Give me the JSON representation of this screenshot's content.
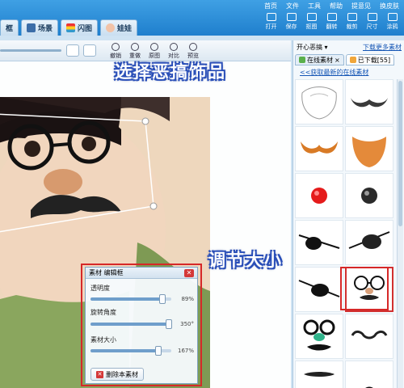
{
  "top_menu": [
    "首页",
    "文件",
    "工具",
    "帮助",
    "提意见",
    "换皮肤"
  ],
  "nav_tabs": [
    {
      "label": "框",
      "icon": "frame-icon"
    },
    {
      "label": "场景",
      "icon": "scene-icon"
    },
    {
      "label": "闪图",
      "icon": "flash-icon"
    },
    {
      "label": "娃娃",
      "icon": "doll-icon"
    }
  ],
  "toolbar": [
    "打开",
    "保存",
    "抠图",
    "翻转",
    "裁剪",
    "尺寸",
    "涂鸦"
  ],
  "edit_buttons": [
    "撤销",
    "重做",
    "原图",
    "对比",
    "预览"
  ],
  "right_panel": {
    "category": "开心恶搞",
    "download_more": "下载更多素材",
    "tabs": [
      {
        "label": "在线素材"
      },
      {
        "label": "已下载[55]"
      }
    ],
    "fetch_link": "<<获取最新的在线素材"
  },
  "annotations": {
    "select": "选择恶搞饰品",
    "resize": "调节大小"
  },
  "edit_box": {
    "title": "素材 编辑框",
    "opacity_label": "透明度",
    "opacity_value": "89%",
    "rotate_label": "旋转角度",
    "rotate_value": "350°",
    "size_label": "素材大小",
    "size_value": "167%",
    "delete_label": "删除本素材",
    "opacity": 0.89,
    "rotate": 350,
    "size": 1.67
  },
  "colors": {
    "header_blue": "#2a8ad8",
    "highlight_red": "#d62828",
    "annotation_outline": "#2a4fb8"
  },
  "stickers": [
    "white-beard",
    "handlebar-mustache",
    "orange-mustache",
    "orange-beard",
    "red-nose",
    "black-ball",
    "pirate-eyepatch-left",
    "pirate-eyepatch-right",
    "eyepatch-strap",
    "groucho-glasses",
    "glasses-green-nose",
    "curly-mustache",
    "thin-mustache",
    "black-shape"
  ]
}
